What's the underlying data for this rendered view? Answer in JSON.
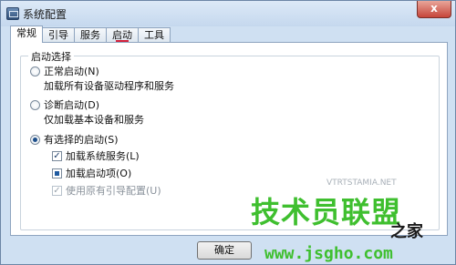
{
  "window": {
    "title": "系统配置",
    "close_label": "x"
  },
  "tabs": [
    {
      "label": "常规",
      "active": true
    },
    {
      "label": "引导",
      "active": false
    },
    {
      "label": "服务",
      "active": false
    },
    {
      "label": "启动",
      "active": false
    },
    {
      "label": "工具",
      "active": false
    }
  ],
  "startup_group": {
    "title": "启动选择",
    "normal": {
      "label": "正常启动(N)",
      "description": "加载所有设备驱动程序和服务",
      "selected": false
    },
    "diagnostic": {
      "label": "诊断启动(D)",
      "description": "仅加载基本设备和服务",
      "selected": false
    },
    "selective": {
      "label": "有选择的启动(S)",
      "selected": true
    },
    "load_services": {
      "label": "加载系统服务(L)",
      "state": "checked"
    },
    "load_startup": {
      "label": "加载启动项(O)",
      "state": "indeterminate"
    },
    "use_boot_config": {
      "label": "使用原有引导配置(U)",
      "state": "checked-disabled"
    }
  },
  "buttons": {
    "ok": "确定"
  },
  "watermark": {
    "main": "技术员联盟",
    "suffix": "之家",
    "url": "www.jsgho.com",
    "faint": "VTRTSTAMIA.NET"
  },
  "colors": {
    "tab_marker": "#d4213b",
    "watermark": "#3fbf2f"
  }
}
